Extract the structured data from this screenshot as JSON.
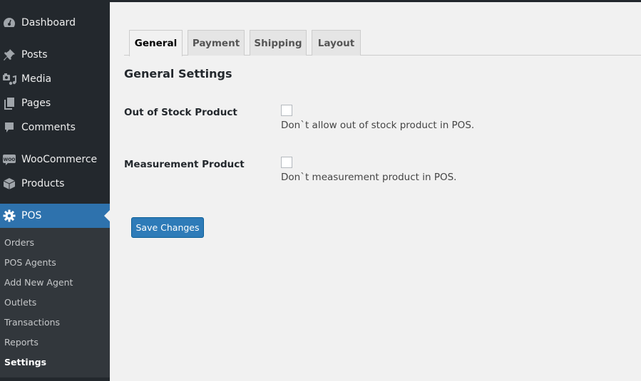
{
  "sidebar": {
    "items": [
      {
        "label": "Dashboard",
        "icon": "dashboard-icon"
      },
      {
        "label": "Posts",
        "icon": "pushpin-icon"
      },
      {
        "label": "Media",
        "icon": "media-icon"
      },
      {
        "label": "Pages",
        "icon": "pages-icon"
      },
      {
        "label": "Comments",
        "icon": "comment-icon"
      },
      {
        "label": "WooCommerce",
        "icon": "woocommerce-icon"
      },
      {
        "label": "Products",
        "icon": "box-icon"
      },
      {
        "label": "POS",
        "icon": "gear-icon",
        "active": true
      }
    ],
    "submenu": [
      {
        "label": "Orders"
      },
      {
        "label": "POS Agents"
      },
      {
        "label": "Add New Agent"
      },
      {
        "label": "Outlets"
      },
      {
        "label": "Transactions"
      },
      {
        "label": "Reports"
      },
      {
        "label": "Settings",
        "current": true
      }
    ],
    "woo_badge": "WOO"
  },
  "tabs": [
    {
      "label": "General",
      "active": true
    },
    {
      "label": "Payment"
    },
    {
      "label": "Shipping"
    },
    {
      "label": "Layout"
    }
  ],
  "section_title": "General Settings",
  "fields": [
    {
      "label": "Out of Stock Product",
      "checked": false,
      "description": "Don`t allow out of stock product in POS."
    },
    {
      "label": "Measurement Product",
      "checked": false,
      "description": "Don`t measurement product in POS."
    }
  ],
  "save_button": "Save Changes",
  "colors": {
    "sidebar_bg": "#23282d",
    "submenu_bg": "#32373c",
    "active_menu": "#2e72ad",
    "button_primary": "#2e7bb8",
    "page_bg": "#f1f1f1"
  }
}
